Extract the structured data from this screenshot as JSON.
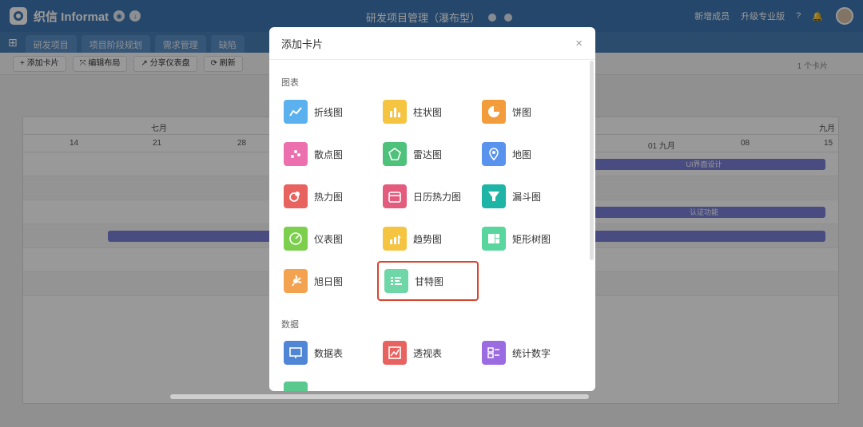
{
  "app": {
    "logo_text": "织信 Informat",
    "project_title": "研发项目管理（瀑布型）"
  },
  "top_right": {
    "new_member": "新增成员",
    "upgrade": "升级专业版",
    "help": "?",
    "bell": "🔔"
  },
  "tabs": [
    "研发项目",
    "项目阶段规划",
    "需求管理",
    "缺陷"
  ],
  "toolbar": {
    "add_card": "添加卡片",
    "edit_layout": "编辑布局",
    "share_dashboard": "分享仪表盘",
    "refresh": "刷新"
  },
  "card_count": "1 个卡片",
  "gantt": {
    "months": [
      "七月",
      "九月"
    ],
    "days": [
      "14",
      "21",
      "28",
      "01 九月",
      "08",
      "15"
    ],
    "bars": [
      "UI界面设计",
      "认证功能"
    ]
  },
  "modal": {
    "title": "添加卡片",
    "close": "×",
    "section_charts": "图表",
    "section_data": "数据",
    "charts": [
      {
        "label": "折线图",
        "icon": "line-chart-icon",
        "color": "#5ab1ee"
      },
      {
        "label": "柱状图",
        "icon": "bar-chart-icon",
        "color": "#f5c542"
      },
      {
        "label": "饼图",
        "icon": "pie-chart-icon",
        "color": "#f39c3c"
      },
      {
        "label": "散点图",
        "icon": "scatter-chart-icon",
        "color": "#ec6fae"
      },
      {
        "label": "雷达图",
        "icon": "radar-chart-icon",
        "color": "#4ec27a"
      },
      {
        "label": "地图",
        "icon": "map-pin-icon",
        "color": "#5a93ee"
      },
      {
        "label": "热力图",
        "icon": "heatmap-icon",
        "color": "#e8625f"
      },
      {
        "label": "日历热力图",
        "icon": "calendar-icon",
        "color": "#e45c7d"
      },
      {
        "label": "漏斗图",
        "icon": "funnel-icon",
        "color": "#1fb5a6"
      },
      {
        "label": "仪表图",
        "icon": "gauge-icon",
        "color": "#7ccf4d"
      },
      {
        "label": "趋势图",
        "icon": "trend-icon",
        "color": "#f5c542"
      },
      {
        "label": "矩形树图",
        "icon": "treemap-icon",
        "color": "#59d69e"
      },
      {
        "label": "旭日图",
        "icon": "sunburst-icon",
        "color": "#f3a24f"
      },
      {
        "label": "甘特图",
        "icon": "gantt-icon",
        "color": "#6fd6a7"
      }
    ],
    "data_items": [
      {
        "label": "数据表",
        "icon": "data-table-icon",
        "color": "#4f86d6"
      },
      {
        "label": "透视表",
        "icon": "pivot-table-icon",
        "color": "#e8625f"
      },
      {
        "label": "统计数字",
        "icon": "statistic-icon",
        "color": "#9b6be2"
      }
    ]
  }
}
